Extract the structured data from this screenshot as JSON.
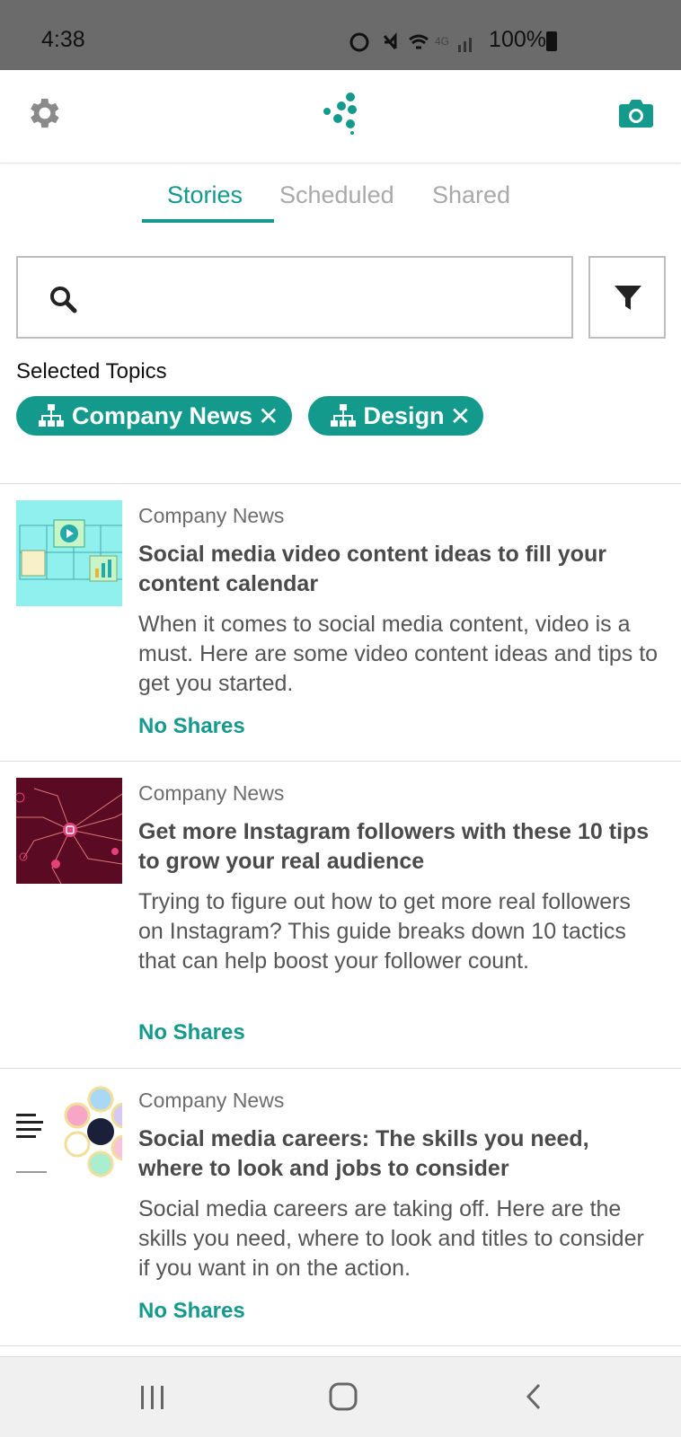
{
  "status_bar": {
    "time": "4:38",
    "battery": "100%"
  },
  "tabs": [
    {
      "label": "Stories",
      "active": true
    },
    {
      "label": "Scheduled",
      "active": false
    },
    {
      "label": "Shared",
      "active": false
    }
  ],
  "search": {
    "value": "",
    "placeholder": ""
  },
  "selected_topics": {
    "title": "Selected Topics",
    "chips": [
      {
        "label": "Company News"
      },
      {
        "label": "Design"
      }
    ]
  },
  "stories": [
    {
      "category": "Company News",
      "title": "Social media video content ideas to fill your content calendar",
      "summary": "When it comes to social media content, video is a must. Here are some video content ideas and tips to get you started.",
      "shares": "No Shares"
    },
    {
      "category": "Company News",
      "title": "Get more Instagram followers with these 10 tips to grow your real audience",
      "summary": "Trying to figure out how to get more real followers on Instagram? This guide breaks down 10 tactics that can help boost your follower count.",
      "shares": "No Shares"
    },
    {
      "category": "Company News",
      "title": "Social media careers: The skills you need, where to look and jobs to consider",
      "summary": "Social media careers are taking off. Here are the skills you need, where to look and titles to consider if you want in on the action.",
      "shares": "No Shares"
    }
  ],
  "colors": {
    "accent": "#14998d",
    "status_bar": "#6b6b6b"
  }
}
